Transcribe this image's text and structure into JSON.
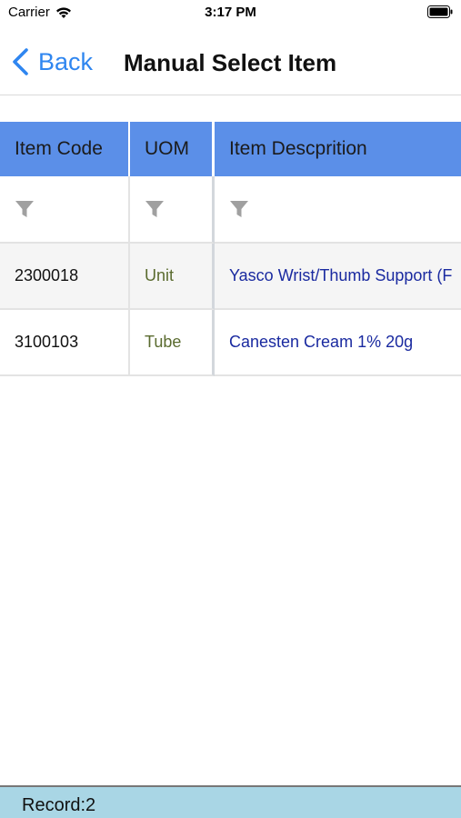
{
  "status_bar": {
    "carrier": "Carrier",
    "time": "3:17 PM",
    "icons": [
      "wifi-icon",
      "battery-icon"
    ]
  },
  "nav": {
    "back_label": "Back",
    "title": "Manual Select Item",
    "back_icon": "chevron-left-icon",
    "accent_color": "#2f86f0"
  },
  "table": {
    "header_color": "#5b8fe8",
    "columns": [
      "Item Code",
      "UOM",
      "Item Descprition"
    ],
    "filter_icon": "filter-icon",
    "rows": [
      {
        "code": "2300018",
        "uom": "Unit",
        "description": "Yasco Wrist/Thumb Support (F"
      },
      {
        "code": "3100103",
        "uom": "Tube",
        "description": "Canesten Cream 1% 20g"
      }
    ]
  },
  "footer": {
    "record_text": "Record:2",
    "color": "#a9d6e5"
  }
}
